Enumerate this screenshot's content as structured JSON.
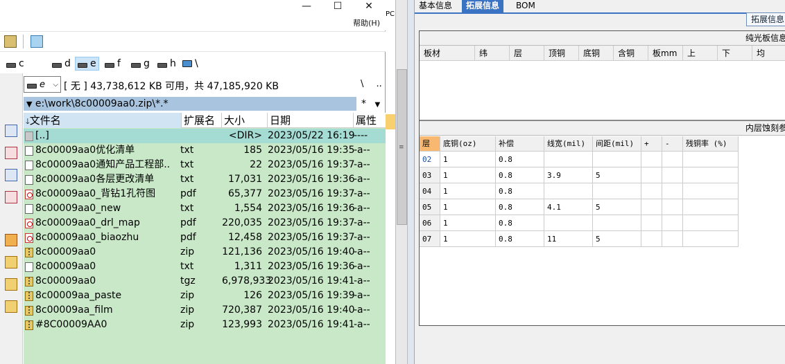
{
  "window": {
    "menu_help": "帮助(H)",
    "min_glyph": "—",
    "max_glyph": "☐",
    "close_glyph": "✕"
  },
  "drives": [
    {
      "label": "c",
      "selected": false
    },
    {
      "label": "d",
      "selected": false
    },
    {
      "label": "e",
      "selected": true
    },
    {
      "label": "f",
      "selected": false
    },
    {
      "label": "g",
      "selected": false
    },
    {
      "label": "h",
      "selected": false
    },
    {
      "label": "\\",
      "selected": false
    }
  ],
  "drive_select": {
    "value": "e"
  },
  "free_space": "[ 无 ]  43,738,612 KB 可用，共 47,185,920 KB",
  "path_ctl": {
    "root": "\\",
    "up": ".."
  },
  "path": "e:\\work\\8c00009aa0.zip\\*.*",
  "path_star": "*",
  "columns": {
    "name": "文件名",
    "ext": "扩展名",
    "size": "大小",
    "date": "日期",
    "attr": "属性"
  },
  "files": [
    {
      "icon": "up-dir-icon",
      "kind": "up",
      "name": "[..]",
      "ext": "",
      "size": "<DIR>",
      "date": "2023/05/22 16:19",
      "attr": "----"
    },
    {
      "icon": "text-file-icon",
      "kind": "txt",
      "name": "8c00009aa0优化清单",
      "ext": "txt",
      "size": "185",
      "date": "2023/05/16 19:35",
      "attr": "-a--"
    },
    {
      "icon": "text-file-icon",
      "kind": "txt",
      "name": "8c00009aa0通知产品工程部..",
      "ext": "txt",
      "size": "22",
      "date": "2023/05/16 19:37",
      "attr": "-a--"
    },
    {
      "icon": "text-file-icon",
      "kind": "txt",
      "name": "8c00009aa0各层更改清单",
      "ext": "txt",
      "size": "17,031",
      "date": "2023/05/16 19:36",
      "attr": "-a--"
    },
    {
      "icon": "pdf-file-icon",
      "kind": "pdf",
      "name": "8c00009aa0_背钻1孔符图",
      "ext": "pdf",
      "size": "65,377",
      "date": "2023/05/16 19:37",
      "attr": "-a--"
    },
    {
      "icon": "text-file-icon",
      "kind": "txt",
      "name": "8c00009aa0_new",
      "ext": "txt",
      "size": "1,554",
      "date": "2023/05/16 19:36",
      "attr": "-a--"
    },
    {
      "icon": "pdf-file-icon",
      "kind": "pdf",
      "name": "8c00009aa0_drl_map",
      "ext": "pdf",
      "size": "220,035",
      "date": "2023/05/16 19:37",
      "attr": "-a--"
    },
    {
      "icon": "pdf-file-icon",
      "kind": "pdf",
      "name": "8c00009aa0_biaozhu",
      "ext": "pdf",
      "size": "12,458",
      "date": "2023/05/16 19:37",
      "attr": "-a--"
    },
    {
      "icon": "zip-file-icon",
      "kind": "zip",
      "name": "8c00009aa0",
      "ext": "zip",
      "size": "121,136",
      "date": "2023/05/16 19:40",
      "attr": "-a--"
    },
    {
      "icon": "text-file-icon",
      "kind": "txt",
      "name": "8c00009aa0",
      "ext": "txt",
      "size": "1,311",
      "date": "2023/05/16 19:36",
      "attr": "-a--"
    },
    {
      "icon": "zip-file-icon",
      "kind": "zip",
      "name": "8c00009aa0",
      "ext": "tgz",
      "size": "6,978,933",
      "date": "2023/05/16 19:41",
      "attr": "-a--"
    },
    {
      "icon": "zip-file-icon",
      "kind": "zip",
      "name": "8c00009aa_paste",
      "ext": "zip",
      "size": "126",
      "date": "2023/05/16 19:39",
      "attr": "-a--"
    },
    {
      "icon": "zip-file-icon",
      "kind": "zip",
      "name": "8c00009aa_film",
      "ext": "zip",
      "size": "720,387",
      "date": "2023/05/16 19:40",
      "attr": "-a--"
    },
    {
      "icon": "zip-file-icon",
      "kind": "zip",
      "name": "#8C00009AA0",
      "ext": "zip",
      "size": "123,993",
      "date": "2023/05/16 19:41",
      "attr": "-a--"
    }
  ],
  "midcol_label": "PC",
  "right": {
    "tabs": [
      "基本信息",
      "拓展信息",
      "BOM"
    ],
    "active_tab": 1,
    "ext_button": "拓展信息",
    "section1_title": "纯光板信息",
    "table1_headers": [
      "板材",
      "纬",
      "层",
      "顶铜",
      "底铜",
      "含铜",
      "板mm",
      "上",
      "下",
      "均"
    ],
    "section2_title": "内层蚀刻参",
    "table2_headers": [
      "层",
      "底铜(oz)",
      "补偿",
      "线宽(mil)",
      "间距(mil)",
      "+",
      "-",
      "残铜率 (%)"
    ],
    "table2_rows": [
      [
        "02",
        "1",
        "0.8",
        "",
        "",
        "",
        "",
        ""
      ],
      [
        "03",
        "1",
        "0.8",
        "3.9",
        "5",
        "",
        "",
        ""
      ],
      [
        "04",
        "1",
        "0.8",
        "",
        "",
        "",
        "",
        ""
      ],
      [
        "05",
        "1",
        "0.8",
        "4.1",
        "5",
        "",
        "",
        ""
      ],
      [
        "06",
        "1",
        "0.8",
        "",
        "",
        "",
        "",
        ""
      ],
      [
        "07",
        "1",
        "0.8",
        "11",
        "5",
        "",
        "",
        ""
      ]
    ]
  },
  "colors": {
    "grid_bg": "#c8e8c8",
    "selected_row": "#a4dcd4",
    "path_bar": "#a9c4de",
    "active_tab": "#3a72c4"
  }
}
